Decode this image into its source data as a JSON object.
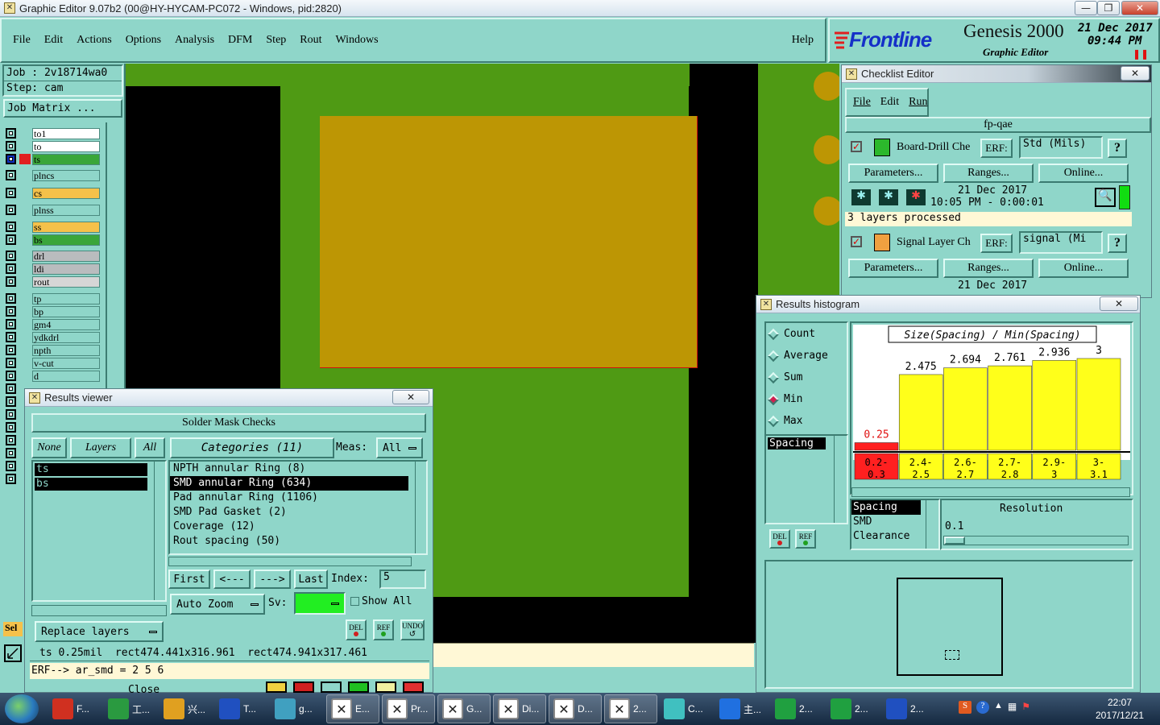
{
  "window": {
    "title": "Graphic Editor 9.07b2 (00@HY-HYCAM-PC072 - Windows, pid:2820)",
    "min": "—",
    "max": "❐",
    "close": "✕"
  },
  "menu": {
    "items": [
      "File",
      "Edit",
      "Actions",
      "Options",
      "Analysis",
      "DFM",
      "Step",
      "Rout",
      "Windows"
    ],
    "help": "Help"
  },
  "brand": {
    "logo": "Frontline",
    "product": "Genesis 2000",
    "subtitle": "Graphic Editor",
    "date": "21 Dec 2017",
    "time": "09:44 PM",
    "pause": "❚❚"
  },
  "job": {
    "job_line": "Job : 2v18714wa0",
    "step_line": "Step: cam",
    "matrix_button": "Job Matrix ..."
  },
  "layers": [
    {
      "name": "to1",
      "color": "#ffffff"
    },
    {
      "name": "to",
      "color": "#ffffff"
    },
    {
      "name": "ts",
      "color": "#3aa63a"
    },
    {
      "name": "plncs",
      "color": "#8fd6c9"
    },
    {
      "name": "cs",
      "color": "#f5c14a"
    },
    {
      "name": "plnss",
      "color": "#8fd6c9"
    },
    {
      "name": "ss",
      "color": "#f5c14a"
    },
    {
      "name": "bs",
      "color": "#3aa63a"
    },
    {
      "name": "drl",
      "color": "#b9bcbe"
    },
    {
      "name": "ldi",
      "color": "#b9bcbe"
    },
    {
      "name": "rout",
      "color": "#d6d6d6"
    },
    {
      "name": "tp",
      "color": "#8fd6c9"
    },
    {
      "name": "bp",
      "color": "#8fd6c9"
    },
    {
      "name": "gm4",
      "color": "#8fd6c9"
    },
    {
      "name": "ydkdrl",
      "color": "#8fd6c9"
    },
    {
      "name": "npth",
      "color": "#8fd6c9"
    },
    {
      "name": "v-cut",
      "color": "#8fd6c9"
    },
    {
      "name": "d",
      "color": "#8fd6c9"
    }
  ],
  "sel_label": "Sel",
  "colors": {
    "board_green": "#4f9a14",
    "pad_gold": "#bd9604",
    "panel": "#8fd6c9",
    "bar_yellow": "#ffff1a",
    "bar_red": "#ff2020"
  },
  "checklist": {
    "title": "Checklist Editor",
    "menu": [
      "File",
      "Edit",
      "Run"
    ],
    "name": "fp-qae",
    "checks": [
      {
        "name": "Board-Drill Che",
        "erf_label": "ERF:",
        "erf_value": "Std (Mils)",
        "help": "?",
        "params": "Parameters...",
        "ranges": "Ranges...",
        "online": "Online...",
        "date": "21 Dec 2017",
        "time": "10:05 PM - 0:00:01",
        "status": "3 layers processed"
      },
      {
        "name": "Signal Layer Ch",
        "erf_label": "ERF:",
        "erf_value": "signal (Mi",
        "help": "?",
        "params": "Parameters...",
        "ranges": "Ranges...",
        "online": "Online...",
        "date": "21 Dec 2017"
      }
    ]
  },
  "results_viewer": {
    "title": "Results viewer",
    "header": "Solder Mask Checks",
    "none": "None",
    "layers_btn": "Layers",
    "all": "All",
    "categories": "Categories (11)",
    "meas_label": "Meas:",
    "meas_value": "All",
    "layer_list": [
      "ts",
      "bs"
    ],
    "category_list": [
      "NPTH annular Ring (8)",
      "SMD annular Ring (634)",
      "Pad annular Ring (1106)",
      "SMD Pad Gasket (2)",
      "Coverage (12)",
      "Rout spacing (50)"
    ],
    "selected_category": 1,
    "nav": [
      "First",
      "<---",
      "--->",
      "Last"
    ],
    "index_label": "Index:",
    "index_value": "5",
    "auto_zoom": "Auto Zoom",
    "sv_label": "Sv:",
    "show_all": "Show All",
    "replace_layers": "Replace layers",
    "del": "DEL",
    "ref": "REF",
    "undo": "UNDO",
    "status1": "ts 0.25mil  rect474.441x316.961  rect474.941x317.461",
    "status2": "ERF--> ar_smd = 2 5 6",
    "close": "Close"
  },
  "histogram": {
    "title": "Results histogram",
    "options": [
      "Count",
      "Average",
      "Sum",
      "Min",
      "Max"
    ],
    "selected_option": "Min",
    "measure_list": [
      "Spacing"
    ],
    "del": "DEL",
    "ref": "REF",
    "chart_title": "Size(Spacing) / Min(Spacing)",
    "resolution_label": "Resolution",
    "resolution_value": "0.1",
    "attr_list": [
      "Spacing",
      "SMD",
      "Clearance"
    ]
  },
  "chart_data": {
    "type": "bar",
    "title": "Size(Spacing) / Min(Spacing)",
    "categories": [
      [
        "0.2-",
        "0.3"
      ],
      [
        "2.4-",
        "2.5"
      ],
      [
        "2.6-",
        "2.7"
      ],
      [
        "2.7-",
        "2.8"
      ],
      [
        "2.9-",
        "3"
      ],
      [
        "3-",
        "3.1"
      ]
    ],
    "values": [
      0.25,
      2.475,
      2.694,
      2.761,
      2.936,
      3
    ],
    "labels": [
      "0.25",
      "2.475",
      "2.694",
      "2.761",
      "2.936",
      "3"
    ],
    "ylim": [
      0,
      3
    ],
    "colors": [
      "#ff2020",
      "#ffff1a",
      "#ffff1a",
      "#ffff1a",
      "#ffff1a",
      "#ffff1a"
    ]
  },
  "taskbar": {
    "items": [
      "F...",
      "工...",
      "兴...",
      "T...",
      "g...",
      "E...",
      "Pr...",
      "G...",
      "Di...",
      "D...",
      "2...",
      "C...",
      "主...",
      "2...",
      "2...",
      "2..."
    ],
    "clock_time": "22:07",
    "clock_date": "2017/12/21"
  }
}
